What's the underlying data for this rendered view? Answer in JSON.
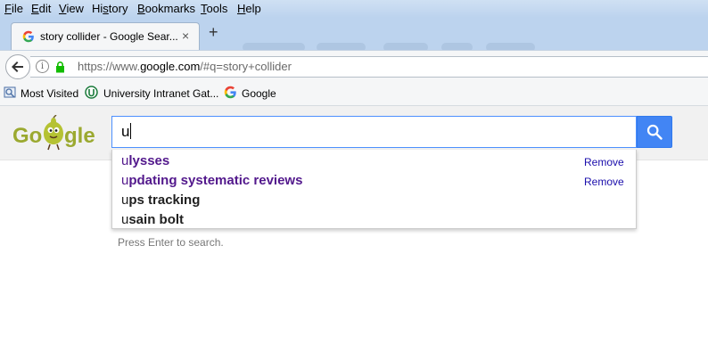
{
  "menu": [
    "File",
    "Edit",
    "View",
    "History",
    "Bookmarks",
    "Tools",
    "Help"
  ],
  "menu_underline": [
    "F",
    "E",
    "V",
    "s",
    "B",
    "T",
    "H"
  ],
  "tab": {
    "title": "story collider - Google Sear...",
    "close": "×"
  },
  "new_tab": "+",
  "url": {
    "prefix": "https://www.",
    "domain": "google.com",
    "suffix": "/#q=story+collider"
  },
  "bookmarks": [
    "Most Visited",
    "University Intranet Gat...",
    "Google"
  ],
  "doodle": {
    "letters": [
      "Go",
      "gle"
    ]
  },
  "search": {
    "value": "u"
  },
  "suggestions": [
    {
      "prefix": "u",
      "rest": "lysses",
      "visited": true,
      "remove": "Remove"
    },
    {
      "prefix": "u",
      "rest": "pdating systematic reviews",
      "visited": true,
      "remove": "Remove"
    },
    {
      "prefix": "u",
      "rest": "ps tracking",
      "visited": false,
      "remove": ""
    },
    {
      "prefix": "u",
      "rest": "sain bolt",
      "visited": false,
      "remove": ""
    }
  ],
  "hint": "Press Enter to search.",
  "colors": {
    "accent": "#4285f4",
    "visited": "#52188c",
    "link": "#1a0dab",
    "doodle": "#9ba930"
  }
}
